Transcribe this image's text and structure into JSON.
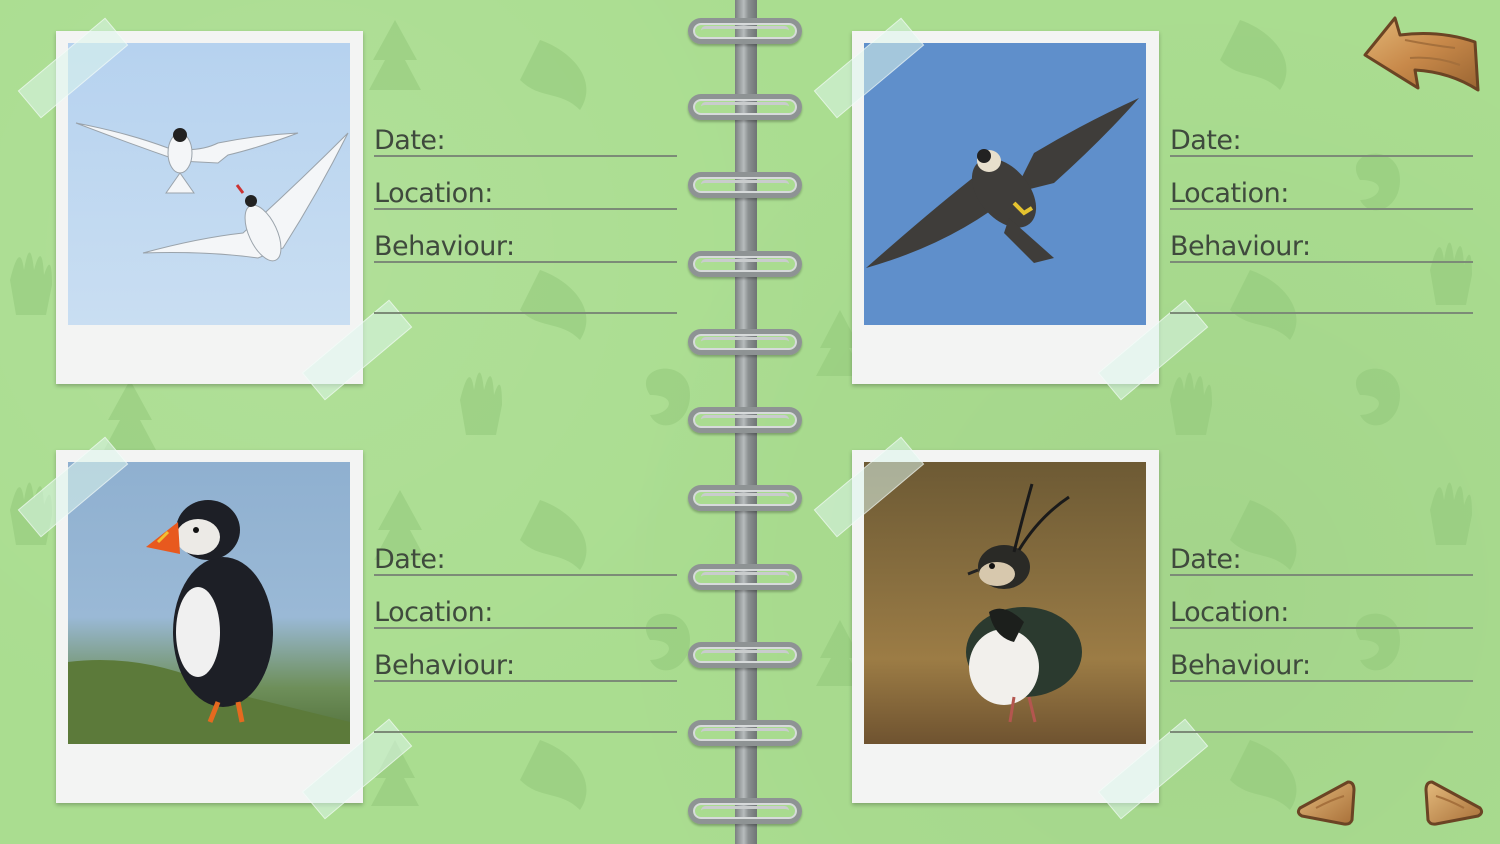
{
  "entries": [
    {
      "photo_subject": "arctic-terns",
      "date_label": "Date:",
      "location_label": "Location:",
      "behaviour_label": "Behaviour:"
    },
    {
      "photo_subject": "peregrine-falcon",
      "date_label": "Date:",
      "location_label": "Location:",
      "behaviour_label": "Behaviour:"
    },
    {
      "photo_subject": "puffin",
      "date_label": "Date:",
      "location_label": "Location:",
      "behaviour_label": "Behaviour:"
    },
    {
      "photo_subject": "lapwing",
      "date_label": "Date:",
      "location_label": "Location:",
      "behaviour_label": "Behaviour:"
    }
  ],
  "navigation": {
    "back_icon": "curved-back-arrow-icon",
    "prev_icon": "left-arrow-icon",
    "next_icon": "right-arrow-icon"
  },
  "colors": {
    "page_green": "#aadd90",
    "label_text": "#3f4a3d",
    "wood": "#c8894a"
  }
}
